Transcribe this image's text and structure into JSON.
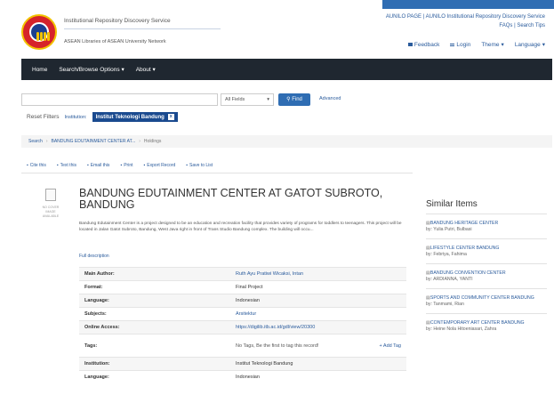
{
  "header": {
    "site_title": "Institutional Repository Discovery Service",
    "site_subtitle": "ASEAN Libraries of ASEAN University Network",
    "right_links": "AUNILO PAGE | AUNILO Institutional Repository Discovery Service",
    "right_links2": "FAQs | Search Tips",
    "feedback": "Feedback",
    "login": "Login",
    "theme": "Theme",
    "language": "Language"
  },
  "nav": {
    "home": "Home",
    "search_browse": "Search/Browse Options",
    "about": "About"
  },
  "search": {
    "field_value": "",
    "select_value": "All Fields",
    "find": "Find",
    "advanced": "Advanced"
  },
  "filters": {
    "label": "Reset Filters",
    "chip_label": "Institution:",
    "active": "Institut Teknologi Bandung",
    "remove": "x"
  },
  "breadcrumb": {
    "items": [
      "Search",
      "BANDUNG EDUTAINMENT CENTER AT...",
      "Holdings"
    ]
  },
  "toolbar": {
    "items": [
      "Cite this",
      "Text this",
      "Email this",
      "Print",
      "Export Record",
      "Save to List"
    ]
  },
  "thumb": {
    "caption": "NO COVER IMAGE AVAILABLE"
  },
  "record": {
    "title": "BANDUNG EDUTAINMENT CENTER AT GATOT SUBROTO, BANDUNG",
    "abstract": "Bandung Edutainment Center is a project designed to be an education and recreation facility that provides variety of programs for toddlers to teenagers. This project will be located in Jalan Gatot Subroto, Bandung, West Java right in front of Trans Studio Bandung complex. The building will occu...",
    "full_description": "Full description",
    "rows": [
      {
        "k": "Main Author:",
        "v": "Ruth Ayu Pratiwi Wicaksi, Intan"
      },
      {
        "k": "Format:",
        "v": "Final Project"
      },
      {
        "k": "Language:",
        "v": "Indonesian"
      },
      {
        "k": "Subjects:",
        "v": "Arsitektur"
      },
      {
        "k": "Online Access:",
        "v": "https://digilib.itb.ac.id/gdl/view/20300"
      },
      {
        "k": "Tags:",
        "v": "No Tags, Be the first to tag this record!",
        "extra": "Add Tag"
      },
      {
        "k": "Institution:",
        "v": "Institut Teknologi Bandung"
      },
      {
        "k": "Language:",
        "v": "Indonesian"
      }
    ]
  },
  "similar": {
    "heading": "Similar Items",
    "items": [
      {
        "title": "BANDUNG HERITAGE CENTER",
        "author": "by: Yulia Putri, Bulbasi"
      },
      {
        "title": "LIFESTYLE CENTER BANDUNG",
        "author": "by: Febriya, Fahima"
      },
      {
        "title": "BANDUNG CONVENTION CENTER",
        "author": "by: ARDIANNA, YANTI"
      },
      {
        "title": "SPORTS AND COMMUNITY CENTER BANDUNG",
        "author": "by: Tanmami, Rian"
      },
      {
        "title": "CONTEMPORARY ART CENTER BANDUNG",
        "author": "by: Heine Nola Hitoeniasari, Zahra"
      }
    ]
  }
}
